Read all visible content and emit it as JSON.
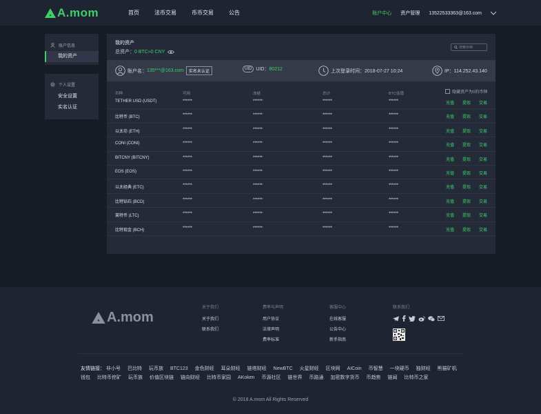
{
  "header": {
    "logo": "A.mom",
    "nav": [
      "首页",
      "法币交易",
      "币币交易",
      "公告"
    ],
    "right": {
      "user_center": "账户中心",
      "asset_mgmt": "资产管理",
      "email": "13522533363@163.com"
    }
  },
  "sidebar": {
    "group1_title": "账户信息",
    "group1_items": [
      "我的资产"
    ],
    "group2_title": "个人设置",
    "group2_items": [
      "安全设置",
      "实名认证"
    ]
  },
  "assets": {
    "title": "我的资产",
    "total_label": "总资产：",
    "total_value": "0 BTC≈0 CNY",
    "search_placeholder": "搜索币种",
    "account_label": "账户名：",
    "account_value": "135***@163.com",
    "verify_label": "实名未认证",
    "uid_badge": "UID",
    "uid_label": "UID：",
    "uid_value": "80212",
    "last_login": "上次登录时间：2018-07-27 10:24",
    "ip": "IP：114.252.43.140",
    "hide_zero": "隐藏资产为0的币种",
    "columns": [
      "币种",
      "可用",
      "冻结",
      "总计",
      "BTC估值"
    ],
    "actions": [
      "充值",
      "提现",
      "交易"
    ],
    "rows": [
      {
        "coin": "TETHER USD (USDT)",
        "avail": "******",
        "frozen": "******",
        "total": "******",
        "btc": "******"
      },
      {
        "coin": "比特币 (BTC)",
        "avail": "******",
        "frozen": "******",
        "total": "******",
        "btc": "******"
      },
      {
        "coin": "以太坊 (ETH)",
        "avail": "******",
        "frozen": "******",
        "total": "******",
        "btc": "******"
      },
      {
        "coin": "CONI (CONI)",
        "avail": "******",
        "frozen": "******",
        "total": "******",
        "btc": "******"
      },
      {
        "coin": "BITCNY (BITCNY)",
        "avail": "******",
        "frozen": "******",
        "total": "******",
        "btc": "******"
      },
      {
        "coin": "EOS (EOS)",
        "avail": "******",
        "frozen": "******",
        "total": "******",
        "btc": "******"
      },
      {
        "coin": "以太经典 (ETC)",
        "avail": "******",
        "frozen": "******",
        "total": "******",
        "btc": "******"
      },
      {
        "coin": "比特钻石 (BCD)",
        "avail": "******",
        "frozen": "******",
        "total": "******",
        "btc": "******"
      },
      {
        "coin": "莱特币 (LTC)",
        "avail": "******",
        "frozen": "******",
        "total": "******",
        "btc": "******"
      },
      {
        "coin": "比特现金 (BCH)",
        "avail": "******",
        "frozen": "******",
        "total": "******",
        "btc": "******"
      }
    ]
  },
  "footer": {
    "logo": "A.mom",
    "about": {
      "title": "关于我们",
      "links": [
        "关于我们",
        "联系我们"
      ]
    },
    "terms": {
      "title": "费率与声明",
      "links": [
        "用户协议",
        "法律声明",
        "费率标准"
      ]
    },
    "service": {
      "title": "客服中心",
      "links": [
        "在线客服",
        "公告中心",
        "新手指南"
      ]
    },
    "contact": {
      "title": "联系我们"
    },
    "friends_label": "友情链接：",
    "friends_row1": [
      "非小号",
      "巴比特",
      "玩币族",
      "BTC123",
      "金色财经",
      "耳朵财经",
      "链塔财经",
      "NewBTC",
      "火星财经",
      "区块网",
      "AICoin",
      "币智慧",
      "一块硬币",
      "独财经",
      "熊猫矿机"
    ],
    "friends_row2": [
      "钱包",
      "比特币挖矿",
      "玩币族",
      "价值区块链",
      "链向财经",
      "比特币家园",
      "AKoken",
      "币源社区",
      "链世界",
      "币路通",
      "加密数字货币",
      "币趋势",
      "链闻",
      "比特币之家"
    ],
    "copyright": "© 2018 A.mom All Rights Reserved"
  }
}
